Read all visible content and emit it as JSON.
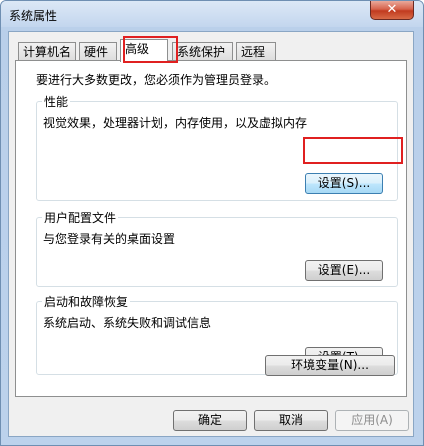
{
  "window": {
    "title": "系统属性",
    "close_label": "✕"
  },
  "tabs": [
    {
      "label": "计算机名"
    },
    {
      "label": "硬件"
    },
    {
      "label": "高级"
    },
    {
      "label": "系统保护"
    },
    {
      "label": "远程"
    }
  ],
  "active_tab": "高级",
  "admin_notice": "要进行大多数更改，您必须作为管理员登录。",
  "performance": {
    "title": "性能",
    "description": "视觉效果，处理器计划，内存使用，以及虚拟内存",
    "settings_button": "设置(S)..."
  },
  "user_profiles": {
    "title": "用户配置文件",
    "description": "与您登录有关的桌面设置",
    "settings_button": "设置(E)..."
  },
  "startup_recovery": {
    "title": "启动和故障恢复",
    "description": "系统启动、系统失败和调试信息",
    "settings_button": "设置(T)..."
  },
  "env_button": "环境变量(N)...",
  "footer": {
    "ok": "确定",
    "cancel": "取消",
    "apply": "应用(A)"
  },
  "highlight_color": "#e02020"
}
